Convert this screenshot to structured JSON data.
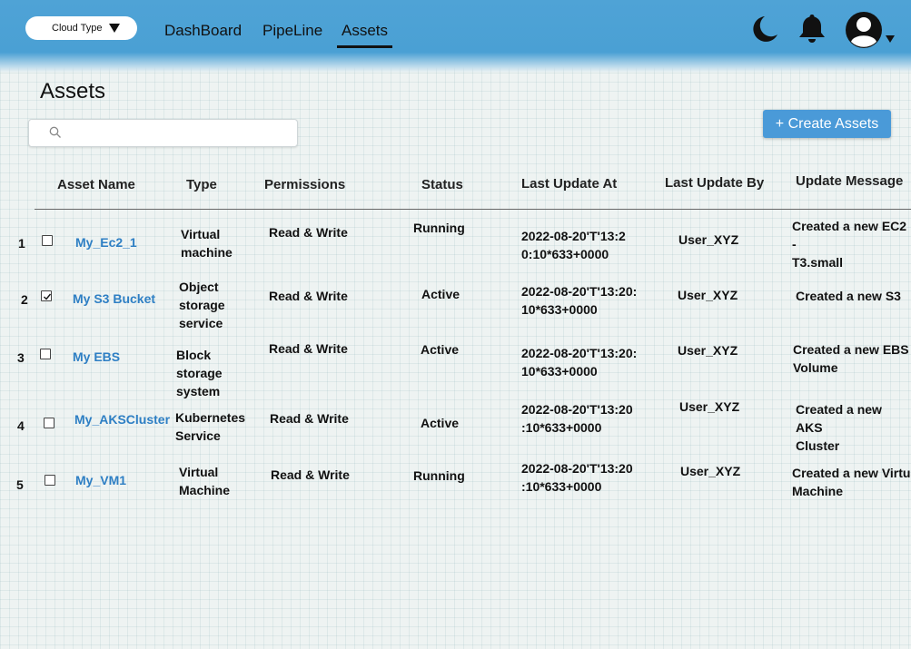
{
  "header": {
    "cloud_select": {
      "value": "Cloud Type"
    },
    "nav": [
      {
        "label": "DashBoard",
        "active": false
      },
      {
        "label": "PipeLine",
        "active": false
      },
      {
        "label": "Assets",
        "active": true
      }
    ],
    "icons": [
      "moon-icon",
      "bell-icon",
      "user-avatar-icon",
      "chevron-down-icon"
    ]
  },
  "page": {
    "title": "Assets"
  },
  "search": {
    "placeholder": "",
    "value": ""
  },
  "actions": {
    "create_label": "+ Create Assets"
  },
  "table": {
    "columns": [
      "Asset Name",
      "Type",
      "Permissions",
      "Status",
      "Last Update At",
      "Last Update By",
      "Update Message"
    ],
    "rows": [
      {
        "num": "1",
        "checked": false,
        "name": "My_Ec2_1",
        "type_lines": [
          "Virtual",
          "machine"
        ],
        "permissions": "Read & Write",
        "status": "Running",
        "updated_at_lines": [
          "2022-08-20'T'13:2",
          "0:10*633+0000"
        ],
        "updated_by": "User_XYZ",
        "message_lines": [
          "Created a new EC2 -",
          "T3.small"
        ]
      },
      {
        "num": "2",
        "checked": true,
        "name": "My S3 Bucket",
        "type_lines": [
          "Object",
          "storage",
          "service"
        ],
        "permissions": "Read & Write",
        "status": "Active",
        "updated_at_lines": [
          "2022-08-20'T'13:20:",
          "10*633+0000"
        ],
        "updated_by": "User_XYZ",
        "message_lines": [
          "Created a new S3"
        ]
      },
      {
        "num": "3",
        "checked": false,
        "name": "My EBS",
        "type_lines": [
          "Block",
          "storage",
          "system"
        ],
        "permissions": "Read & Write",
        "status": "Active",
        "updated_at_lines": [
          "2022-08-20'T'13:20:",
          "10*633+0000"
        ],
        "updated_by": "User_XYZ",
        "message_lines": [
          "Created a new EBS",
          "Volume"
        ]
      },
      {
        "num": "4",
        "checked": false,
        "name": "My_AKSCluster",
        "type_lines": [
          "Kubernetes",
          "Service"
        ],
        "permissions": "Read & Write",
        "status": "Active",
        "updated_at_lines": [
          "2022-08-20'T'13:20",
          ":10*633+0000"
        ],
        "updated_by": "User_XYZ",
        "message_lines": [
          "Created a new AKS",
          "Cluster"
        ]
      },
      {
        "num": "5",
        "checked": false,
        "name": "My_VM1",
        "type_lines": [
          "Virtual",
          "Machine"
        ],
        "permissions": "Read & Write",
        "status": "Running",
        "updated_at_lines": [
          "2022-08-20'T'13:20",
          ":10*633+0000"
        ],
        "updated_by": "User_XYZ",
        "message_lines": [
          "Created a new Virtual",
          "Machine"
        ]
      }
    ]
  }
}
